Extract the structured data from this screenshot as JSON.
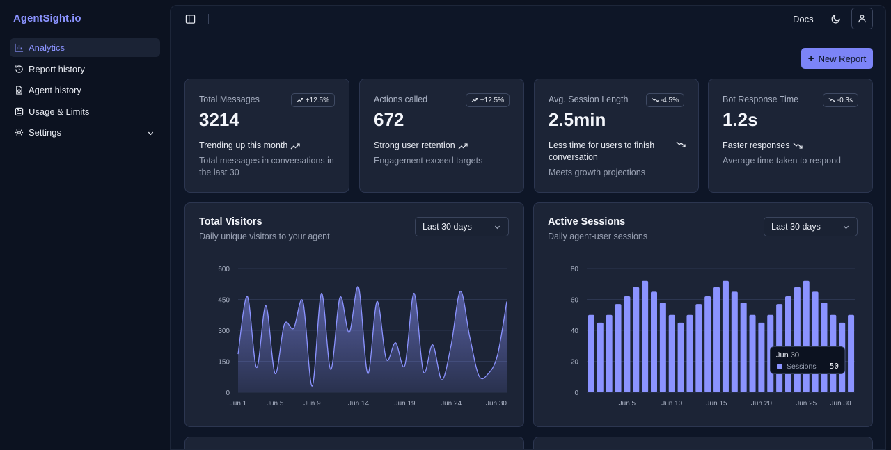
{
  "brand": "AgentSight.io",
  "nav": [
    {
      "label": "Analytics",
      "icon": "bar-chart-icon",
      "active": true
    },
    {
      "label": "Report history",
      "icon": "history-icon"
    },
    {
      "label": "Agent history",
      "icon": "agent-file-icon"
    },
    {
      "label": "Usage & Limits",
      "icon": "usage-icon"
    },
    {
      "label": "Settings",
      "icon": "gear-icon"
    }
  ],
  "topbar": {
    "docs": "Docs",
    "toggle_icon": "sidebar-toggle-icon",
    "theme_icon": "moon-icon",
    "user_icon": "user-icon"
  },
  "actions": {
    "new_report": "New Report"
  },
  "stats": [
    {
      "label": "Total Messages",
      "badge": "+12.5%",
      "badge_dir": "up",
      "value": "3214",
      "trend": "Trending up this month",
      "trend_dir": "up",
      "desc": "Total messages in conversations in the last 30"
    },
    {
      "label": "Actions called",
      "badge": "+12.5%",
      "badge_dir": "up",
      "value": "672",
      "trend": "Strong user retention",
      "trend_dir": "up",
      "desc": "Engagement exceed targets"
    },
    {
      "label": "Avg. Session Length",
      "badge": "-4.5%",
      "badge_dir": "down",
      "value": "2.5min",
      "trend": "Less time for users to finish conversation",
      "trend_dir": "down",
      "desc": "Meets growth projections"
    },
    {
      "label": "Bot Response Time",
      "badge": "-0.3s",
      "badge_dir": "down",
      "value": "1.2s",
      "trend": "Faster responses",
      "trend_dir": "down",
      "desc": "Average time taken to respond"
    }
  ],
  "charts": {
    "visitors": {
      "title": "Total Visitors",
      "subtitle": "Daily unique visitors to your agent",
      "range": "Last 30 days"
    },
    "sessions": {
      "title": "Active Sessions",
      "subtitle": "Daily agent-user sessions",
      "range": "Last 30 days",
      "tooltip": {
        "date": "Jun 30",
        "series": "Sessions",
        "value": "50"
      }
    }
  },
  "colors": {
    "accent": "#8b93ff",
    "button": "#7c84f7",
    "card": "#1c2436",
    "background": "#0c1220"
  },
  "chart_data": [
    {
      "type": "area",
      "x_ticks": [
        "Jun 1",
        "Jun 5",
        "Jun 9",
        "Jun 14",
        "Jun 19",
        "Jun 24",
        "Jun 30"
      ],
      "y_ticks": [
        "0",
        "150",
        "300",
        "450",
        "600"
      ],
      "ylim": [
        0,
        600
      ],
      "x": [
        "Jun 1",
        "Jun 2",
        "Jun 3",
        "Jun 4",
        "Jun 5",
        "Jun 6",
        "Jun 7",
        "Jun 8",
        "Jun 9",
        "Jun 10",
        "Jun 11",
        "Jun 12",
        "Jun 13",
        "Jun 14",
        "Jun 15",
        "Jun 16",
        "Jun 17",
        "Jun 18",
        "Jun 19",
        "Jun 20",
        "Jun 21",
        "Jun 22",
        "Jun 23",
        "Jun 24",
        "Jun 25",
        "Jun 26",
        "Jun 27",
        "Jun 28",
        "Jun 29",
        "Jun 30"
      ],
      "values": [
        185,
        465,
        120,
        420,
        90,
        330,
        310,
        440,
        30,
        480,
        110,
        460,
        290,
        510,
        90,
        440,
        160,
        240,
        130,
        480,
        100,
        230,
        60,
        230,
        490,
        270,
        80,
        90,
        180,
        440
      ],
      "grid": true
    },
    {
      "type": "bar",
      "x_ticks": [
        "Jun 5",
        "Jun 10",
        "Jun 15",
        "Jun 20",
        "Jun 25",
        "Jun 30"
      ],
      "y_ticks": [
        "0",
        "20",
        "40",
        "60",
        "80"
      ],
      "ylim": [
        0,
        80
      ],
      "x": [
        "Jun 1",
        "Jun 2",
        "Jun 3",
        "Jun 4",
        "Jun 5",
        "Jun 6",
        "Jun 7",
        "Jun 8",
        "Jun 9",
        "Jun 10",
        "Jun 11",
        "Jun 12",
        "Jun 13",
        "Jun 14",
        "Jun 15",
        "Jun 16",
        "Jun 17",
        "Jun 18",
        "Jun 19",
        "Jun 20",
        "Jun 21",
        "Jun 22",
        "Jun 23",
        "Jun 24",
        "Jun 25",
        "Jun 26",
        "Jun 27",
        "Jun 28",
        "Jun 29",
        "Jun 30"
      ],
      "values": [
        50,
        45,
        50,
        57,
        62,
        68,
        72,
        65,
        58,
        50,
        45,
        50,
        57,
        62,
        68,
        72,
        65,
        58,
        50,
        45,
        50,
        57,
        62,
        68,
        72,
        65,
        58,
        50,
        45,
        50
      ],
      "grid": true
    }
  ]
}
